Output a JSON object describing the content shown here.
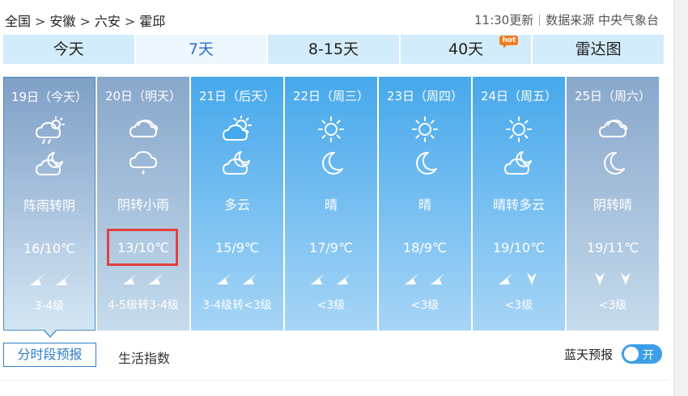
{
  "breadcrumb": [
    "全国",
    "安徽",
    "六安",
    "霍邱"
  ],
  "breadcrumb_sep": ">",
  "update_time": "11:30更新",
  "data_source": "数据来源 中央气象台",
  "tabs": [
    {
      "label": "今天",
      "active": false
    },
    {
      "label": "7天",
      "active": true
    },
    {
      "label": "8-15天",
      "active": false
    },
    {
      "label": "40天",
      "active": false,
      "badge": "hot"
    },
    {
      "label": "雷达图",
      "active": false
    }
  ],
  "days": [
    {
      "date": "19日（今天）",
      "weather": "阵雨转阴",
      "temp": "16/10℃",
      "level": "3-4级",
      "icons": [
        "shower-cloud-sun-icon",
        "night-cloud-icon"
      ],
      "winds": [
        "wind-arrow-icon",
        "wind-arrow-icon"
      ],
      "bg": [
        "#7f9fc7",
        "#c9dcec"
      ]
    },
    {
      "date": "20日（明天）",
      "weather": "阴转小雨",
      "temp": "13/10℃",
      "level": "4-5级转3-4级",
      "icons": [
        "overcast-icon",
        "light-rain-icon"
      ],
      "winds": [
        "wind-arrow-icon",
        "wind-arrow-icon"
      ],
      "bg": [
        "#88a7cb",
        "#c6dbec"
      ]
    },
    {
      "date": "21日（后天）",
      "weather": "多云",
      "temp": "15/9℃",
      "level": "3-4级转<3级",
      "icons": [
        "partly-cloudy-icon",
        "night-cloud-icon"
      ],
      "winds": [
        "wind-arrow-icon",
        "wind-arrow-icon"
      ],
      "bg": [
        "#46a8ec",
        "#a7d5f6"
      ]
    },
    {
      "date": "22日（周三）",
      "weather": "晴",
      "temp": "17/9℃",
      "level": "<3级",
      "icons": [
        "sun-icon",
        "moon-icon"
      ],
      "winds": [
        "wind-arrow-icon",
        "wind-arrow-icon"
      ],
      "bg": [
        "#46a8ec",
        "#a7d5f6"
      ]
    },
    {
      "date": "23日（周四）",
      "weather": "晴",
      "temp": "18/9℃",
      "level": "<3级",
      "icons": [
        "sun-icon",
        "moon-icon"
      ],
      "winds": [
        "wind-arrow-icon",
        "wind-arrow-icon"
      ],
      "bg": [
        "#46a8ec",
        "#a7d5f6"
      ]
    },
    {
      "date": "24日（周五）",
      "weather": "晴转多云",
      "temp": "19/10℃",
      "level": "<3级",
      "icons": [
        "sun-icon",
        "night-cloud-icon"
      ],
      "winds": [
        "wind-arrow-icon",
        "wind-down-icon"
      ],
      "bg": [
        "#46a8ec",
        "#a7d5f6"
      ]
    },
    {
      "date": "25日（周六）",
      "weather": "阴转晴",
      "temp": "19/11℃",
      "level": "<3级",
      "icons": [
        "overcast-icon",
        "moon-icon"
      ],
      "winds": [
        "wind-down-icon",
        "wind-down-icon"
      ],
      "bg": [
        "#88a7cb",
        "#c6dbec"
      ]
    }
  ],
  "bottom": {
    "hourly_button": "分时段预报",
    "life_index": "生活指数",
    "blue_sky_label": "蓝天预报",
    "toggle_label": "开"
  },
  "colors": {
    "accent": "#2e7dc7",
    "highlight": "#e3403e"
  }
}
